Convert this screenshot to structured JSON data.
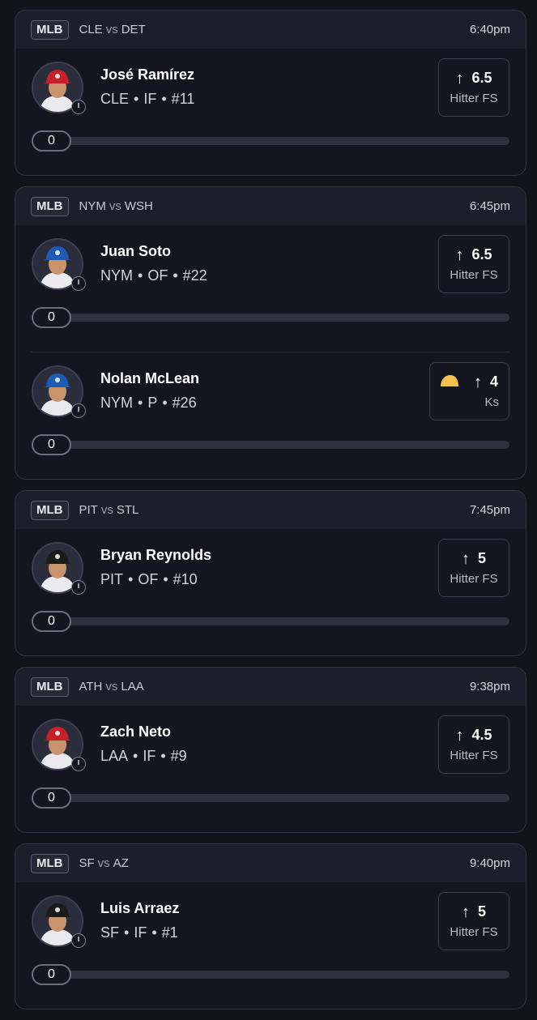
{
  "colors": {
    "background": "#12131b",
    "card": "#14151e",
    "card_header": "#1d1e29",
    "border": "#33354a",
    "track": "#2f3140"
  },
  "cards": [
    {
      "league": "MLB",
      "team_a": "CLE",
      "vs": "vs",
      "team_b": "DET",
      "time": "6:40pm",
      "picks": [
        {
          "name": "José Ramírez",
          "team": "CLE",
          "position": "IF",
          "number": "#11",
          "projection": "6.5",
          "stat": "Hitter FS",
          "direction_icon": "arrow-up-icon",
          "slider_value": "0",
          "slider_fraction": 0,
          "helmet_color": "#c8202b"
        }
      ]
    },
    {
      "league": "MLB",
      "team_a": "NYM",
      "vs": "vs",
      "team_b": "WSH",
      "time": "6:45pm",
      "picks": [
        {
          "name": "Juan Soto",
          "team": "NYM",
          "position": "OF",
          "number": "#22",
          "projection": "6.5",
          "stat": "Hitter FS",
          "direction_icon": "arrow-up-icon",
          "slider_value": "0",
          "slider_fraction": 0,
          "helmet_color": "#1d5bb5"
        },
        {
          "name": "Nolan McLean",
          "team": "NYM",
          "position": "P",
          "number": "#26",
          "projection": "4",
          "stat": "Ks",
          "direction_icon": "arrow-up-icon",
          "badge_icon": "taco-icon",
          "slider_value": "0",
          "slider_fraction": 0,
          "helmet_color": "#1d5bb5"
        }
      ]
    },
    {
      "league": "MLB",
      "team_a": "PIT",
      "vs": "vs",
      "team_b": "STL",
      "time": "7:45pm",
      "picks": [
        {
          "name": "Bryan Reynolds",
          "team": "PIT",
          "position": "OF",
          "number": "#10",
          "projection": "5",
          "stat": "Hitter FS",
          "direction_icon": "arrow-up-icon",
          "slider_value": "0",
          "slider_fraction": 0,
          "helmet_color": "#1b1b1b"
        }
      ]
    },
    {
      "league": "MLB",
      "team_a": "ATH",
      "vs": "vs",
      "team_b": "LAA",
      "time": "9:38pm",
      "picks": [
        {
          "name": "Zach Neto",
          "team": "LAA",
          "position": "IF",
          "number": "#9",
          "projection": "4.5",
          "stat": "Hitter FS",
          "direction_icon": "arrow-up-icon",
          "slider_value": "0",
          "slider_fraction": 0,
          "helmet_color": "#c8202b"
        }
      ]
    },
    {
      "league": "MLB",
      "team_a": "SF",
      "vs": "vs",
      "team_b": "AZ",
      "time": "9:40pm",
      "picks": [
        {
          "name": "Luis Arraez",
          "team": "SF",
          "position": "IF",
          "number": "#1",
          "projection": "5",
          "stat": "Hitter FS",
          "direction_icon": "arrow-up-icon",
          "slider_value": "0",
          "slider_fraction": 0,
          "helmet_color": "#1b1b1b"
        }
      ]
    }
  ]
}
